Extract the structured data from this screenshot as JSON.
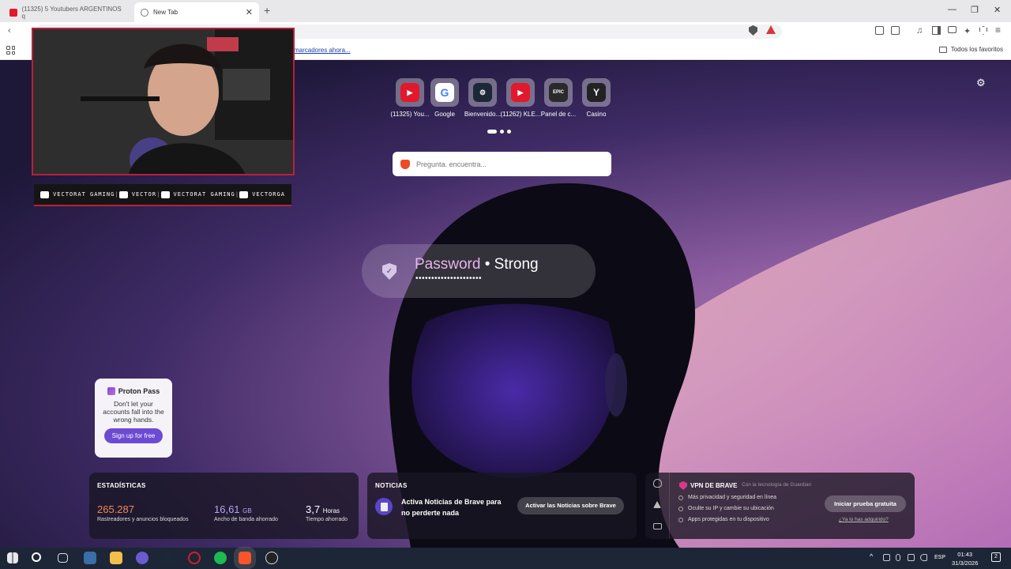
{
  "tabs": [
    {
      "title": "(11325) 5 Youtubers ARGENTINOS q",
      "icon": "youtube-icon",
      "active": false
    },
    {
      "title": "New Tab",
      "icon": "globe-icon",
      "active": true
    }
  ],
  "window_controls": {
    "minimize": "—",
    "restore": "❐",
    "close": "✕",
    "new_tab": "+"
  },
  "bookmarks_bar": {
    "import_link": "marcadores ahora...",
    "favorites_folder": "Todos los favoritos"
  },
  "top_sites": [
    {
      "label": "(11325) You...",
      "icon": "youtube-icon",
      "color": "#e1192c",
      "glyph": "▶"
    },
    {
      "label": "Google",
      "icon": "google-icon",
      "color": "#ffffff",
      "glyph": "G"
    },
    {
      "label": "Bienvenido...",
      "icon": "steam-icon",
      "color": "#1b2838",
      "glyph": "⚙"
    },
    {
      "label": "(11262) KLE...",
      "icon": "youtube-icon",
      "color": "#e1192c",
      "glyph": "▶"
    },
    {
      "label": "Panel de c...",
      "icon": "epic-games-icon",
      "color": "#2a2a2a",
      "glyph": "EPIC"
    },
    {
      "label": "Casino",
      "icon": "casino-icon",
      "color": "#222222",
      "glyph": "Y"
    }
  ],
  "search": {
    "placeholder": "Pregunta. encuentra..."
  },
  "password_widget": {
    "word": "Password",
    "separator": " • ",
    "strength": "Strong",
    "dots": "•••••••••••••••••••••"
  },
  "webcam_socials": [
    {
      "icon": "youtube-icon",
      "label": "VECTORAT GAMING"
    },
    {
      "icon": "twitch-icon",
      "label": "VECTOR"
    },
    {
      "icon": "twitter-icon",
      "label": "VECTORAT GAMING"
    },
    {
      "icon": "instagram-icon",
      "label": "VECTORGA"
    }
  ],
  "proton": {
    "brand": "Proton Pass",
    "text": "Don't let your accounts fall into the wrong hands.",
    "button": "Sign up for free"
  },
  "stats": {
    "title": "ESTADÍSTICAS",
    "trackers_value": "265.287",
    "trackers_label": "Rastreadores y anuncios bloqueados",
    "bandwidth_value": "16,61",
    "bandwidth_unit": "GB",
    "bandwidth_label": "Ancho de banda ahorrado",
    "time_value": "3,7",
    "time_unit": "Horas",
    "time_label": "Tiempo ahorrado",
    "trackers_color": "#f0875a",
    "bandwidth_color": "#b7a7f0"
  },
  "news": {
    "title": "NOTICIAS",
    "text": "Activa Noticias de Brave para no perderte nada",
    "button": "Activar las Noticias sobre Brave"
  },
  "vpn": {
    "title": "VPN DE BRAVE",
    "powered_by": "Con la tecnología de  Guardian",
    "features": [
      "Más privacidad y seguridad en línea",
      "Oculte su IP y cambie su ubicación",
      "Apps protegidas en tu dispositivo"
    ],
    "button": "Iniciar prueba gratuita",
    "link": "¿Ya lo has adquirido?"
  },
  "taskbar": {
    "lang": "ESP",
    "time": "01:43",
    "date": "31/3/2026",
    "notifications": "2"
  }
}
